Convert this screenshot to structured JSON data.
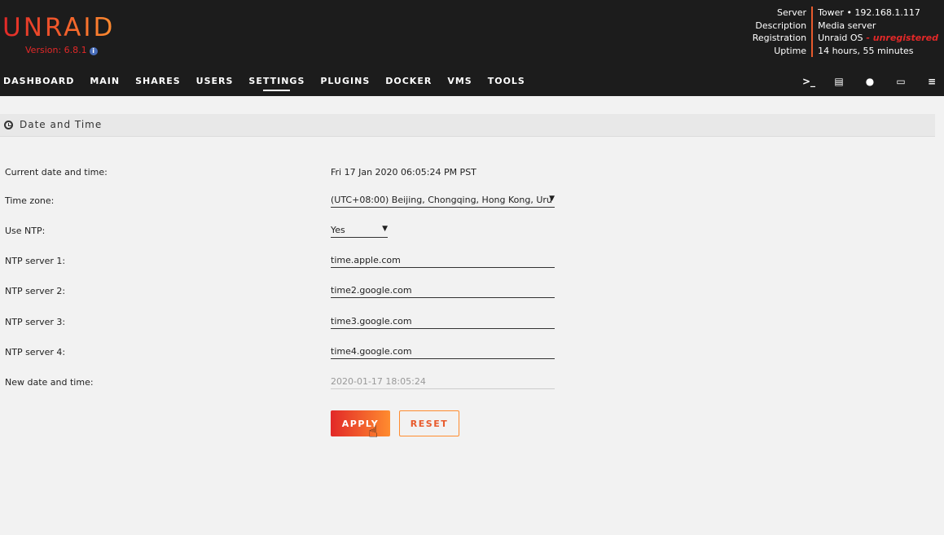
{
  "header": {
    "logo": "UNRAID",
    "version": "Version: 6.8.1",
    "server_info": {
      "labels": [
        "Server",
        "Description",
        "Registration",
        "Uptime"
      ],
      "server": "Tower • 192.168.1.117",
      "description": "Media server",
      "registration_prefix": "Unraid OS",
      "registration_status": " - unregistered",
      "uptime": "14 hours, 55 minutes"
    },
    "nav": [
      "DASHBOARD",
      "MAIN",
      "SHARES",
      "USERS",
      "SETTINGS",
      "PLUGINS",
      "DOCKER",
      "VMS",
      "TOOLS"
    ],
    "active_nav": "SETTINGS"
  },
  "section": {
    "title": "Date and Time"
  },
  "form": {
    "current_label": "Current date and time:",
    "current_value": "Fri 17 Jan 2020 06:05:24 PM PST",
    "timezone_label": "Time zone:",
    "timezone_value": "(UTC+08:00) Beijing, Chongqing, Hong Kong, Uru",
    "ntp_label": "Use NTP:",
    "ntp_value": "Yes",
    "ntp1_label": "NTP server 1:",
    "ntp1_value": "time.apple.com",
    "ntp2_label": "NTP server 2:",
    "ntp2_value": "time2.google.com",
    "ntp3_label": "NTP server 3:",
    "ntp3_value": "time3.google.com",
    "ntp4_label": "NTP server 4:",
    "ntp4_value": "time4.google.com",
    "new_label": "New date and time:",
    "new_value": "2020-01-17 18:05:24"
  },
  "buttons": {
    "apply": "APPLY",
    "reset": "RESET"
  },
  "colors": {
    "accent_start": "#e22828",
    "accent_end": "#ff8c2f",
    "header_bg": "#1c1c1c"
  }
}
